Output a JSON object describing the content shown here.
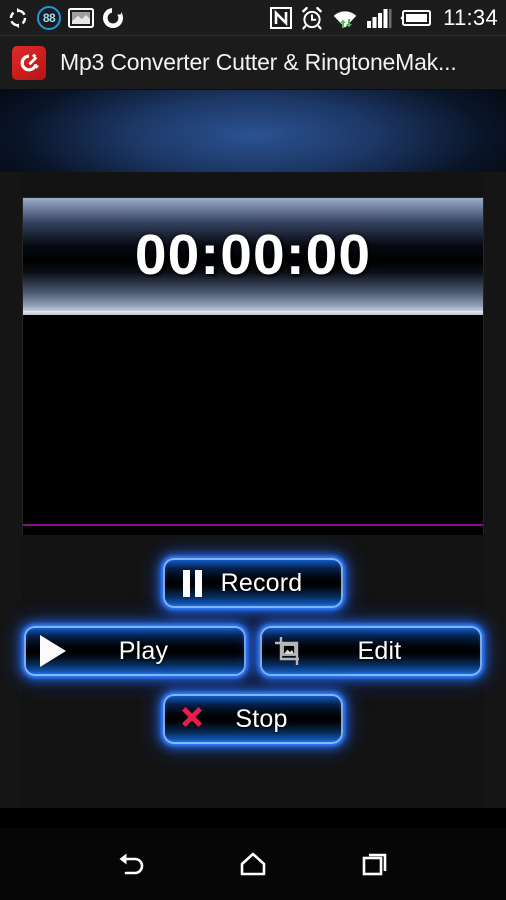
{
  "status_bar": {
    "icons_left": [
      {
        "name": "sync-icon",
        "label": "sync"
      },
      {
        "name": "battery-level-icon",
        "label": "88"
      },
      {
        "name": "screenshot-icon",
        "label": "screenshot"
      },
      {
        "name": "rotation-icon",
        "label": "rotation"
      }
    ],
    "battery_percent": "88",
    "icons_right": [
      {
        "name": "nfc-icon",
        "label": "NFC"
      },
      {
        "name": "alarm-icon",
        "label": "alarm"
      },
      {
        "name": "wifi-icon",
        "label": "wifi"
      },
      {
        "name": "signal-icon",
        "label": "signal"
      },
      {
        "name": "battery-icon",
        "label": "battery"
      }
    ],
    "clock": "11:34"
  },
  "app_bar": {
    "icon_name": "app-logo-icon",
    "title": "Mp3 Converter Cutter & RingtoneMak..."
  },
  "editor": {
    "timer_value": "00:00:00",
    "waveform_baseline_color": "#8e0d8a"
  },
  "controls": {
    "record": {
      "label": "Record",
      "icon": "pause-icon"
    },
    "play": {
      "label": "Play",
      "icon": "play-icon"
    },
    "edit": {
      "label": "Edit",
      "icon": "crop-image-icon"
    },
    "stop": {
      "label": "Stop",
      "icon": "close-x-icon"
    }
  },
  "nav_bar": {
    "back": "back-icon",
    "home": "home-icon",
    "recents": "recent-apps-icon"
  },
  "colors": {
    "accent_blue": "#2f7dfa",
    "banner_blue": "#2b5291",
    "stop_red": "#e81c4e",
    "app_icon_red": "#d11f1f",
    "baseline_purple": "#8e0d8a"
  }
}
